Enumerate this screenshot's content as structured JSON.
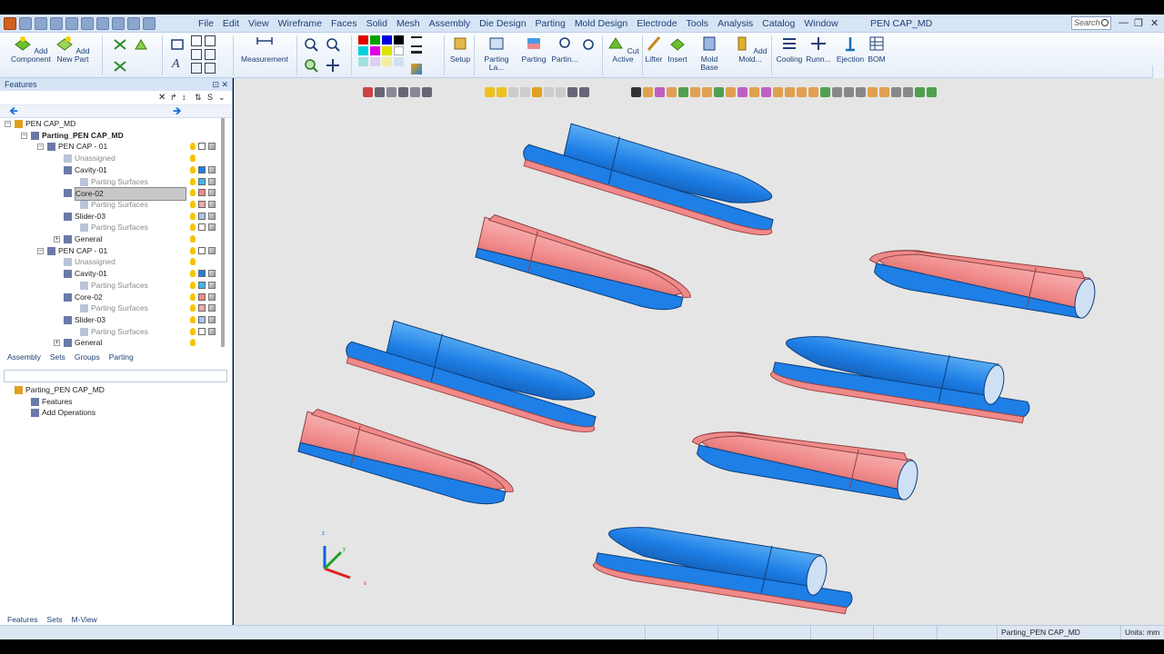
{
  "window": {
    "title": "PEN CAP_MD",
    "search_placeholder": "Search"
  },
  "menu": [
    "File",
    "Edit",
    "View",
    "Wireframe",
    "Faces",
    "Solid",
    "Mesh",
    "Assembly",
    "Die Design",
    "Parting",
    "Mold Design",
    "Electrode",
    "Tools",
    "Analysis",
    "Catalog",
    "Window"
  ],
  "ribbon": {
    "add_component": "Add Component",
    "add_new_part": "Add New Part",
    "measurement": "Measurement",
    "setup": "Setup",
    "parting_la": "Parting La...",
    "parting": "Parting",
    "partin": "Partin...",
    "cut_active": "Cut Active",
    "lifter": "Lifter",
    "insert": "Insert",
    "mold_base": "Mold Base",
    "add_mold": "Add Mold...",
    "cooling": "Cooling",
    "runn": "Runn...",
    "ejection": "Ejection",
    "bom": "BOM"
  },
  "features_panel": {
    "title": "Features",
    "tree": [
      {
        "label": "PEN CAP_MD",
        "indent": 0
      },
      {
        "label": "Parting_PEN CAP_MD",
        "indent": 1,
        "bold": true
      },
      {
        "label": "PEN CAP - 01",
        "indent": 2
      },
      {
        "label": "Unassigned",
        "indent": 3,
        "dim": true
      },
      {
        "label": "Cavity-01",
        "indent": 3,
        "color": "#1e7fe6"
      },
      {
        "label": "Parting Surfaces",
        "indent": 4,
        "dim": true,
        "color": "#3fb8ea"
      },
      {
        "label": "Core-02",
        "indent": 3,
        "color": "#f08a8a",
        "selected": true
      },
      {
        "label": "Parting Surfaces",
        "indent": 4,
        "dim": true,
        "color": "#f3a8a8"
      },
      {
        "label": "Slider-03",
        "indent": 3,
        "color": "#a8c4e8"
      },
      {
        "label": "Parting Surfaces",
        "indent": 4,
        "dim": true,
        "color": "#ffffff"
      },
      {
        "label": "General",
        "indent": 3
      },
      {
        "label": "PEN CAP - 01",
        "indent": 2
      },
      {
        "label": "Unassigned",
        "indent": 3,
        "dim": true
      },
      {
        "label": "Cavity-01",
        "indent": 3,
        "color": "#1e7fe6"
      },
      {
        "label": "Parting Surfaces",
        "indent": 4,
        "dim": true,
        "color": "#3fb8ea"
      },
      {
        "label": "Core-02",
        "indent": 3,
        "color": "#f08a8a"
      },
      {
        "label": "Parting Surfaces",
        "indent": 4,
        "dim": true,
        "color": "#f3a8a8"
      },
      {
        "label": "Slider-03",
        "indent": 3,
        "color": "#a8c4e8"
      },
      {
        "label": "Parting Surfaces",
        "indent": 4,
        "dim": true,
        "color": "#ffffff"
      },
      {
        "label": "General",
        "indent": 3
      }
    ],
    "tabs": [
      "Assembly",
      "Sets",
      "Groups",
      "Parting"
    ]
  },
  "lower_panel": {
    "tree": [
      {
        "label": "Parting_PEN CAP_MD",
        "indent": 0
      },
      {
        "label": "Features",
        "indent": 1
      },
      {
        "label": "Add Operations",
        "indent": 1
      }
    ],
    "tabs": [
      "Features",
      "Sets",
      "M-View"
    ]
  },
  "status": {
    "active_part": "Parting_PEN CAP_MD",
    "units": "Units: mm"
  },
  "axis": {
    "x": "x",
    "y": "y",
    "z": "z"
  },
  "colors": {
    "cavity": "#1e7fe6",
    "core": "#f08a8a",
    "viewport": "#e5e5e5"
  }
}
